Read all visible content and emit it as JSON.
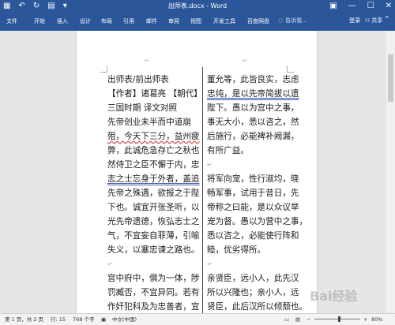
{
  "window": {
    "title": "出师表.docx - Word",
    "controls": [
      "minimize-icon",
      "maximize-icon",
      "close-icon"
    ]
  },
  "quick_access": {
    "icons": [
      "save-icon",
      "undo-icon",
      "redo-icon",
      "customize-qat-icon"
    ]
  },
  "ribbon": {
    "tabs": [
      "文件",
      "开始",
      "插入",
      "设计",
      "布局",
      "引用",
      "邮件",
      "审阅",
      "视图",
      "开发工具",
      "百度网盘"
    ],
    "tell_me": "告诉我...",
    "login": "登录",
    "share": "共享"
  },
  "document": {
    "left_column": [
      "出师表/前出师表",
      "【作者】诸葛亮 【朝代】",
      "三国时期  译文对照",
      "先帝创业未半而中道崩",
      "殂，今天下三分，益州疲",
      "弊，此诚危急存亡之秋也",
      "然侍卫之臣不懈于内，忠",
      "志之士忘身于外者，盖追",
      "先帝之殊遇，欲报之于陛",
      "下也。诚宜开张圣听，以",
      "光先帝遗德，恢弘志士之",
      "气，不宜妄自菲薄，引喻",
      "失义，以塞忠谏之路也。",
      "",
      "宫中府中，俱为一体，陟",
      "罚臧否，不宜异同。若有",
      "作奸犯科及为忠善者，宜"
    ],
    "right_column": [
      "董允等，此皆良实，志虑",
      "忠纯，是以先帝简拔以遗",
      "陛下。愚以为宫中之事，",
      "事无大小，悉以咨之，然",
      "后施行，必能裨补阙漏，",
      "有所广益。",
      "",
      "将军向宠，性行淑均，晓",
      "畅军事，试用于昔日，先",
      "帝称之曰能，是以众议举",
      "宠为督。愚以为营中之事，",
      "悉以咨之，必能使行阵和",
      "睦，优劣得所。",
      "",
      "亲贤臣，远小人，此先汉",
      "所以兴隆也；亲小人，远",
      "贤臣，此后汉所以倾颓也。"
    ]
  },
  "status_bar": {
    "page": "第 1 页，共 2 页",
    "pos": "行: 15",
    "words": "768 个字",
    "proof_icon": "proofing-icon",
    "language": "中文(中国)",
    "zoom": "80%",
    "zoom_minus": "−",
    "zoom_plus": "+"
  },
  "watermark": "Bai经验",
  "colors": {
    "word_blue": "#2b579a",
    "spelling_red": "#d04040",
    "grammar_blue": "#3b5bb5"
  }
}
